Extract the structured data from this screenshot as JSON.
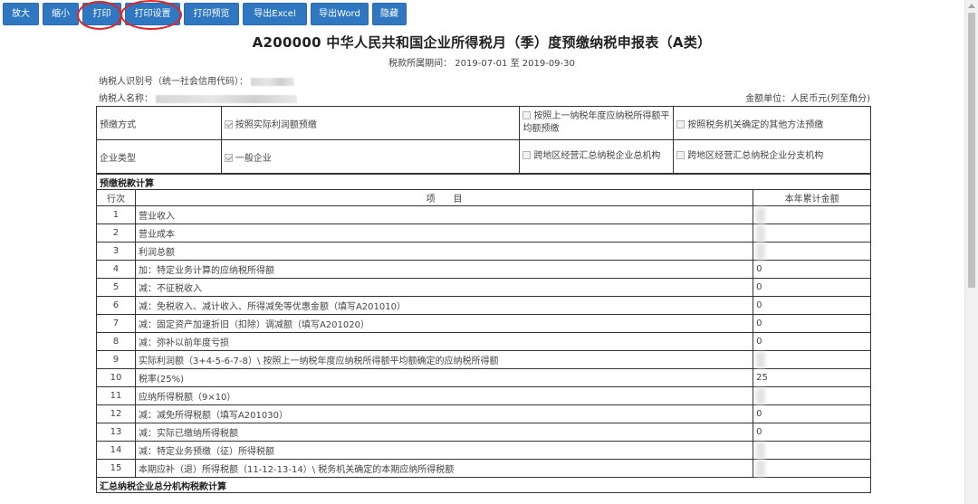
{
  "toolbar": {
    "buttons": [
      "放大",
      "缩小",
      "打印",
      "打印设置",
      "打印预览",
      "导出Excel",
      "导出Word",
      "隐藏"
    ]
  },
  "form": {
    "title": "A200000 中华人民共和国企业所得税月（季）度预缴纳税申报表（A类）",
    "period": "税款所属期间： 2019-07-01 至 2019-09-30",
    "taxpayer_id_label": "纳税人识别号（统一社会信用代码）：",
    "taxpayer_name_label": "纳税人名称：",
    "unit": "金额单位：人民币元(列至角分)"
  },
  "prepay": {
    "method_label": "预缴方式",
    "method_options": [
      {
        "label": "按照实际利润额预缴",
        "checked": true
      },
      {
        "label": "按照上一纳税年度应纳税所得额平均额预缴",
        "checked": false
      },
      {
        "label": "按照税务机关确定的其他方法预缴",
        "checked": false
      }
    ],
    "type_label": "企业类型",
    "type_options": [
      {
        "label": "一般企业",
        "checked": true
      },
      {
        "label": "跨地区经营汇总纳税企业总机构",
        "checked": false
      },
      {
        "label": "跨地区经营汇总纳税企业分支机构",
        "checked": false
      }
    ]
  },
  "calc": {
    "section_title": "预缴税款计算",
    "col_row": "行次",
    "col_item": "项　　目",
    "col_amount": "本年累计金额",
    "rows": [
      {
        "n": "1",
        "item": "营业收入",
        "amount": ""
      },
      {
        "n": "2",
        "item": "营业成本",
        "amount": ""
      },
      {
        "n": "3",
        "item": "利润总额",
        "amount": ""
      },
      {
        "n": "4",
        "item": "加：特定业务计算的应纳税所得额",
        "amount": "0"
      },
      {
        "n": "5",
        "item": "减：不征税收入",
        "amount": "0"
      },
      {
        "n": "6",
        "item": "减：免税收入、减计收入、所得减免等优惠金额（填写A201010）",
        "amount": "0"
      },
      {
        "n": "7",
        "item": "减：固定资产加速折旧（扣除）调减额（填写A201020）",
        "amount": "0"
      },
      {
        "n": "8",
        "item": "减：弥补以前年度亏损",
        "amount": "0"
      },
      {
        "n": "9",
        "item": "实际利润额（3+4-5-6-7-8）\\ 按照上一纳税年度应纳税所得额平均额确定的应纳税所得额",
        "amount": ""
      },
      {
        "n": "10",
        "item": "税率(25%)",
        "amount": "25"
      },
      {
        "n": "11",
        "item": "应纳所得税额（9×10）",
        "amount": ""
      },
      {
        "n": "12",
        "item": "减：减免所得税额（填写A201030）",
        "amount": "0"
      },
      {
        "n": "13",
        "item": "减：实际已缴纳所得税额",
        "amount": "0"
      },
      {
        "n": "14",
        "item": "减：特定业务预缴（征）所得税额",
        "amount": ""
      },
      {
        "n": "15",
        "item": "本期应补（退）所得税额（11-12-13-14）\\ 税务机关确定的本期应纳所得税额",
        "amount": ""
      }
    ],
    "next_section_title": "汇总纳税企业总分机构税款计算"
  },
  "colors": {
    "button_bg": "#2f77c0",
    "highlight_ring": "#e52424"
  }
}
